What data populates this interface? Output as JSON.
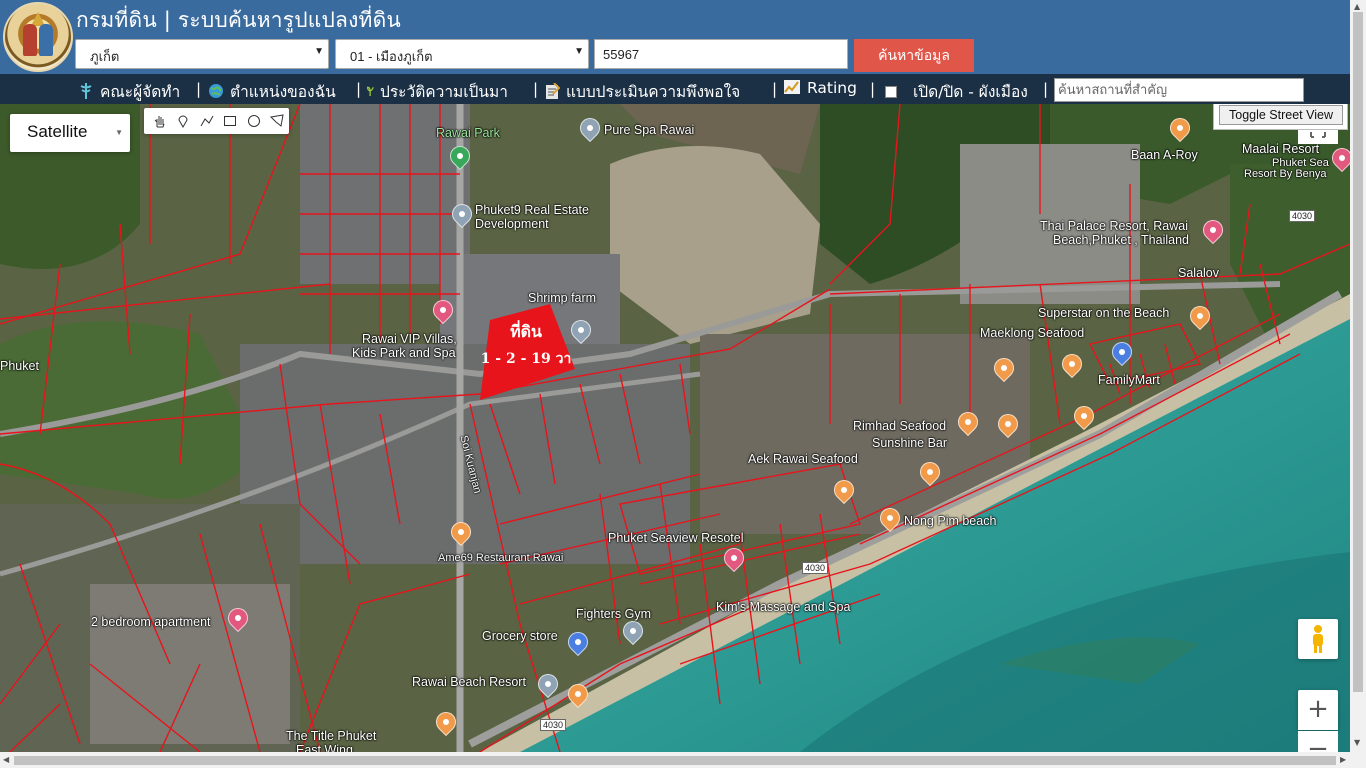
{
  "header": {
    "title": "กรมที่ดิน | ระบบค้นหารูปแปลงที่ดิน",
    "province": "ภูเก็ต",
    "district": "01 - เมืองภูเก็ต",
    "parcel_number": "55967",
    "search_button": "ค้นหาข้อมูล"
  },
  "nav": {
    "items": [
      {
        "label": "คณะผู้จัดทำ",
        "icon": "caduceus-icon"
      },
      {
        "label": "ตำแหน่งของฉัน",
        "icon": "globe-icon"
      },
      {
        "label": "ประวัติความเป็นมา",
        "icon": "sprout-icon"
      },
      {
        "label": "แบบประเมินความพึงพอใจ",
        "icon": "clipboard-icon"
      },
      {
        "label": "Rating",
        "icon": "chart-icon"
      },
      {
        "label": "เปิด/ปิด - ผังเมือง",
        "icon": "checkbox-icon"
      }
    ],
    "place_search_placeholder": "ค้นหาสถานที่สำคัญ"
  },
  "map": {
    "map_type": "Satellite",
    "street_view_button": "Toggle Street View",
    "zoom_in": "+",
    "zoom_out": "−",
    "parcel": {
      "title": "ที่ดิน",
      "area": "1 - 2 - 19 วา",
      "color": "#e8141c"
    },
    "pois": [
      {
        "name": "Rawai Park"
      },
      {
        "name": "Pure Spa Rawai"
      },
      {
        "name": "Phuket9 Real Estate"
      },
      {
        "name": "Development"
      },
      {
        "name": "Shrimp farm"
      },
      {
        "name": "Rawai VIP Villas,"
      },
      {
        "name": "Kids Park and Spa"
      },
      {
        "name": "Phuket"
      },
      {
        "name": "Baan A-Roy"
      },
      {
        "name": "Maalai Resort"
      },
      {
        "name": "Phuket Sea"
      },
      {
        "name": "Resort By Benya"
      },
      {
        "name": "Thai Palace Resort, Rawai"
      },
      {
        "name": "Beach,Phuket , Thailand"
      },
      {
        "name": "Salalov"
      },
      {
        "name": "Superstar on the Beach"
      },
      {
        "name": "Maeklong Seafood"
      },
      {
        "name": "FamilyMart"
      },
      {
        "name": "Rimhad Seafood"
      },
      {
        "name": "Sunshine Bar"
      },
      {
        "name": "Aek Rawai Seafood"
      },
      {
        "name": "Nong Pim beach"
      },
      {
        "name": "Phuket Seaview Resotel"
      },
      {
        "name": "Ame69 Restaurant Rawai"
      },
      {
        "name": "Kim's Massage and Spa"
      },
      {
        "name": "Fighters Gym"
      },
      {
        "name": "Grocery store"
      },
      {
        "name": "2 bedroom apartment"
      },
      {
        "name": "Rawai Beach Resort"
      },
      {
        "name": "The Title Phuket"
      },
      {
        "name": "East Wing"
      },
      {
        "name": "Soi Kuanjan"
      }
    ],
    "road_shields": [
      "4030",
      "4030",
      "4030"
    ]
  }
}
